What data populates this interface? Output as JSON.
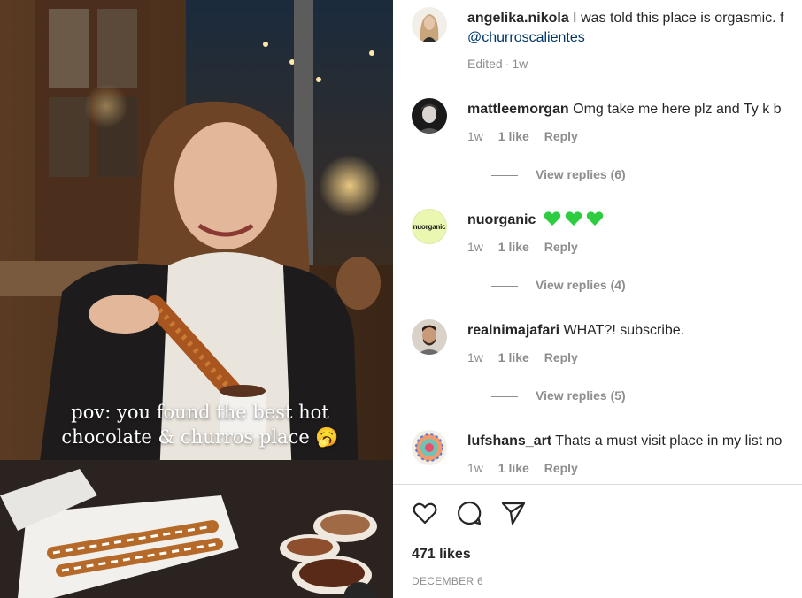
{
  "post": {
    "overlay_text": "pov: you found the best hot\nchocolate & churros place 🥱",
    "author": {
      "username": "angelika.nikola",
      "caption": "I was told this place is orgasmic. f",
      "mention": "@churroscalientes",
      "edited": "Edited",
      "dot": "·",
      "time": "1w"
    }
  },
  "comments": [
    {
      "username": "mattleemorgan",
      "text": "Omg take me here plz and Ty k b",
      "time": "1w",
      "likes": "1 like",
      "reply": "Reply",
      "view_replies": "View replies (6)",
      "avatar_icon": "avatar-man-dark"
    },
    {
      "username": "nuorganic",
      "text": "",
      "emoji_hearts": [
        "green-heart-icon",
        "green-heart-icon",
        "green-heart-icon"
      ],
      "time": "1w",
      "likes": "1 like",
      "reply": "Reply",
      "view_replies": "View replies (4)",
      "avatar_text": "nuorganic",
      "avatar_color": "#e9f7b0"
    },
    {
      "username": "realnimajafari",
      "text": "WHAT?! subscribe.",
      "time": "1w",
      "likes": "1 like",
      "reply": "Reply",
      "view_replies": "View replies (5)",
      "avatar_icon": "avatar-man-beard"
    },
    {
      "username": "lufshans_art",
      "text": "Thats a must visit place in my list no",
      "time": "1w",
      "likes": "1 like",
      "reply": "Reply",
      "avatar_icon": "avatar-art"
    }
  ],
  "footer": {
    "likes": "471 likes",
    "date": "DECEMBER 6"
  },
  "colors": {
    "text": "#262626",
    "muted": "#8e8e8e",
    "link": "#00376b",
    "heart": "#2ecc40"
  }
}
